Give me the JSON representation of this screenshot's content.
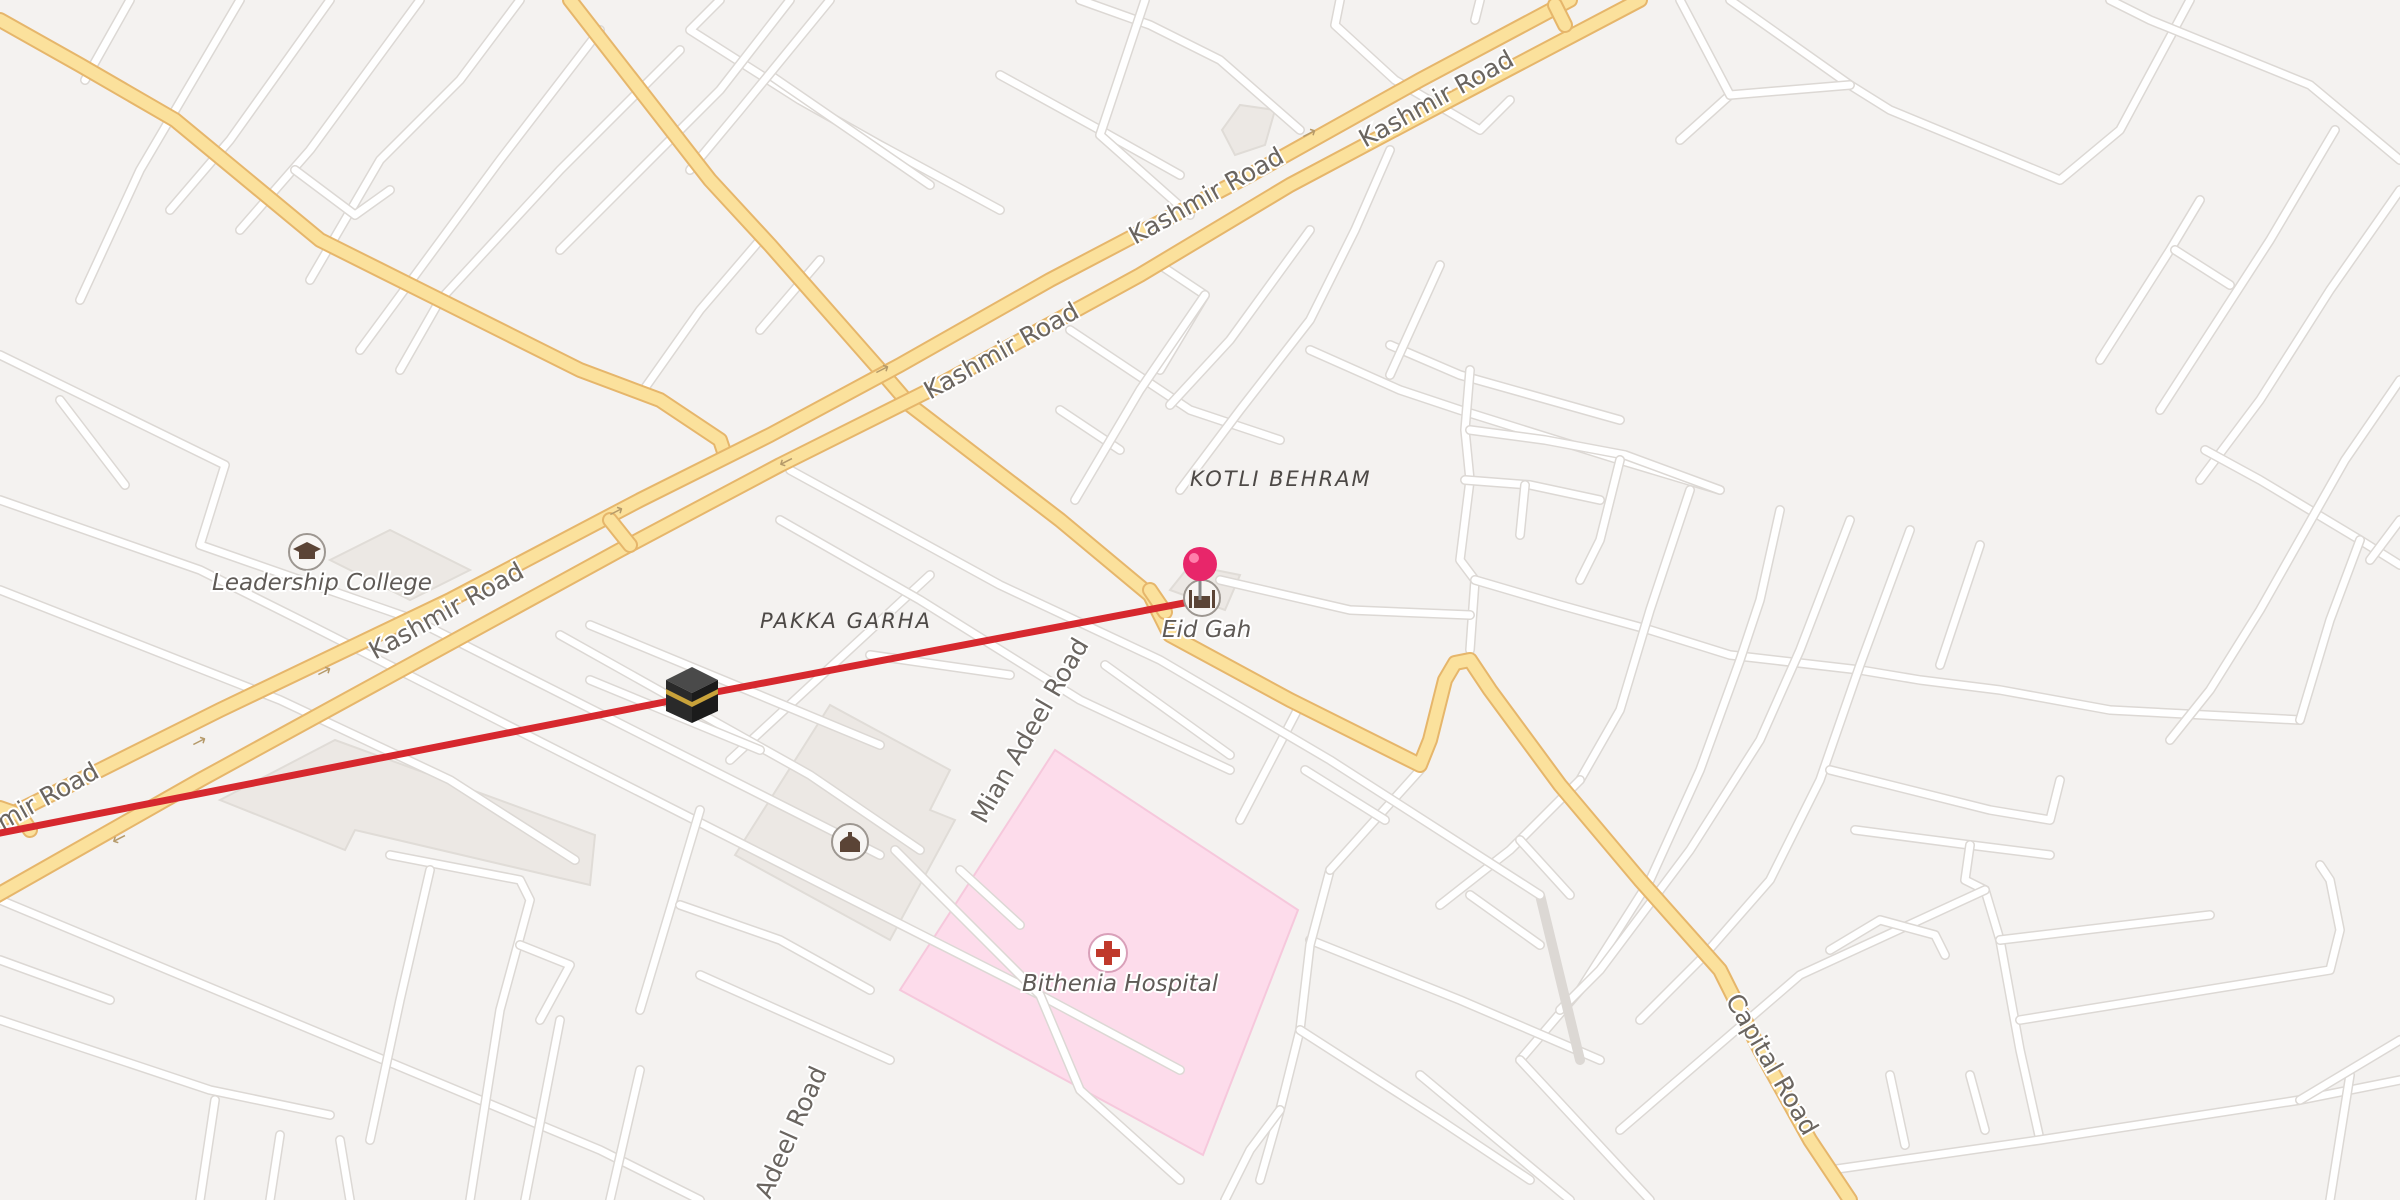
{
  "map": {
    "roads": {
      "kashmir_1": "Kashmir Road",
      "kashmir_2": "Kashmir Road",
      "kashmir_3": "Kashmir Road",
      "kashmir_4": "Kashmir Road",
      "kashmir_5": "Kashmir Road",
      "mian_adeel_1": "Mian Adeel Road",
      "mian_adeel_2": "Adeel Road",
      "capital": "Capital Road"
    },
    "places": {
      "kotli_behram": "KOTLI BEHRAM",
      "pakka_garha": "PAKKA GARHA"
    },
    "pois": {
      "leadership_college": "Leadership College",
      "eid_gah": "Eid Gah",
      "bithenia_hospital": "Bithenia Hospital"
    },
    "icons": {
      "college": "graduation-cap-icon",
      "mosque": "mosque-icon",
      "hospital": "hospital-cross-icon",
      "kaaba": "kaaba-icon",
      "pin": "location-pin-icon"
    },
    "colors": {
      "background": "#f4f2f0",
      "major_road": "#fbe19c",
      "minor_road": "#ffffff",
      "route_line": "#d6282e",
      "pin": "#e8266a",
      "hospital_area": "#fdddea"
    }
  }
}
